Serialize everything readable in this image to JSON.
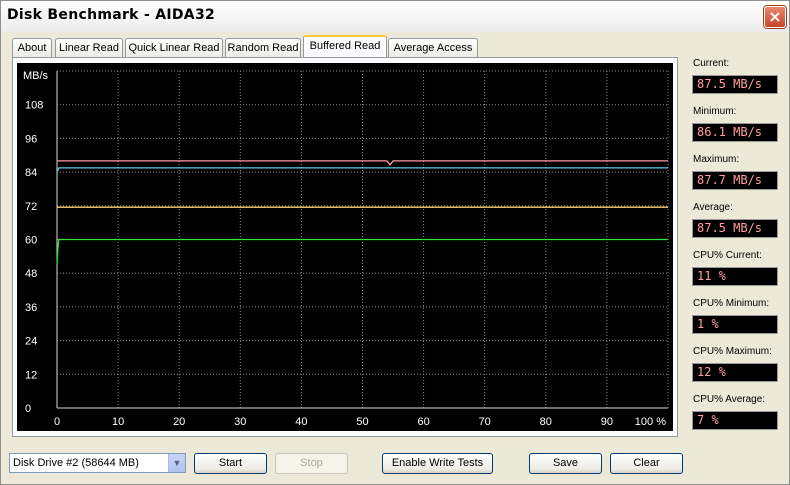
{
  "window": {
    "title": "Disk Benchmark - AIDA32",
    "close_icon": "×"
  },
  "tabs": [
    {
      "label": "About",
      "active": false
    },
    {
      "label": "Linear Read",
      "active": false
    },
    {
      "label": "Quick Linear Read",
      "active": false
    },
    {
      "label": "Random Read",
      "active": false
    },
    {
      "label": "Buffered Read",
      "active": true
    },
    {
      "label": "Average Access",
      "active": false
    }
  ],
  "stats": [
    {
      "label": "Current:",
      "value": "87.5 MB/s"
    },
    {
      "label": "Minimum:",
      "value": "86.1 MB/s"
    },
    {
      "label": "Maximum:",
      "value": "87.7 MB/s"
    },
    {
      "label": "Average:",
      "value": "87.5 MB/s"
    },
    {
      "label": "CPU% Current:",
      "value": "11 %"
    },
    {
      "label": "CPU% Minimum:",
      "value": "1 %"
    },
    {
      "label": "CPU% Maximum:",
      "value": "12 %"
    },
    {
      "label": "CPU% Average:",
      "value": "7 %"
    }
  ],
  "controls": {
    "drive": "Disk Drive #2  (58644 MB)",
    "start": "Start",
    "stop": "Stop",
    "enable_write": "Enable Write Tests",
    "save": "Save",
    "clear": "Clear"
  },
  "chart_data": {
    "type": "line",
    "ylabel": "MB/s",
    "ylim": [
      0,
      120
    ],
    "yticks": [
      "0",
      "12",
      "24",
      "36",
      "48",
      "60",
      "72",
      "84",
      "96",
      "108"
    ],
    "xlim": [
      0,
      100
    ],
    "xticks": [
      "0",
      "10",
      "20",
      "30",
      "40",
      "50",
      "60",
      "70",
      "80",
      "90",
      "100 %"
    ],
    "grid": true,
    "series": [
      {
        "color": "#ff9da0",
        "x": [
          0,
          54,
          54.5,
          55,
          100
        ],
        "y": [
          88,
          88,
          86.6,
          88,
          88
        ]
      },
      {
        "color": "#5ad0f0",
        "x": [
          0,
          0.3,
          100
        ],
        "y": [
          84,
          85.5,
          85.5
        ]
      },
      {
        "color": "#ffd070",
        "x": [
          0,
          100
        ],
        "y": [
          71.5,
          71.5
        ]
      },
      {
        "color": "#38e038",
        "x": [
          0,
          0.15,
          0.3,
          0.6,
          100
        ],
        "y": [
          51,
          57,
          60,
          60,
          60
        ]
      }
    ]
  }
}
